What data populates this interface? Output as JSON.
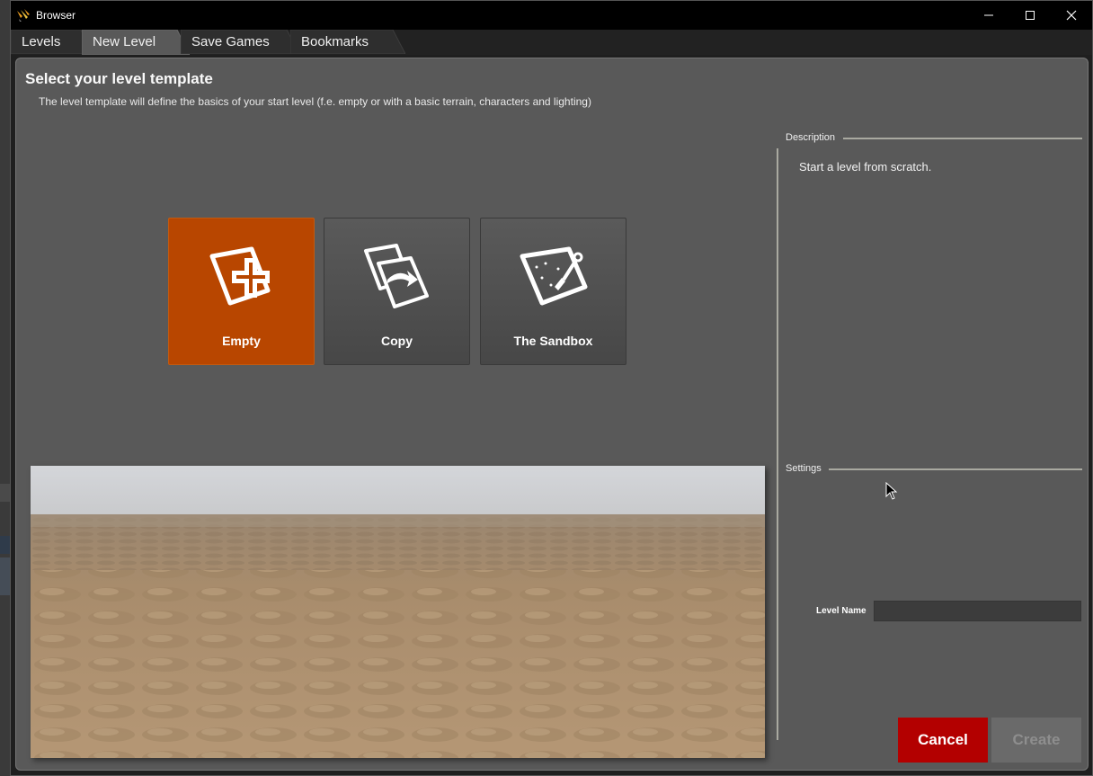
{
  "window": {
    "title": "Browser",
    "controls": {
      "minimize": "minimize-icon",
      "maximize": "maximize-icon",
      "close": "close-icon"
    }
  },
  "tabs": [
    {
      "label": "Levels",
      "active": false
    },
    {
      "label": "New Level",
      "active": true
    },
    {
      "label": "Save Games",
      "active": false
    },
    {
      "label": "Bookmarks",
      "active": false
    }
  ],
  "main": {
    "heading": "Select your level template",
    "subheading": "The level template will define the basics of your start level (f.e. empty or with a basic terrain, characters and lighting)",
    "templates": [
      {
        "label": "Empty",
        "icon": "new-level-plus-icon",
        "selected": true
      },
      {
        "label": "Copy",
        "icon": "copy-level-icon",
        "selected": false
      },
      {
        "label": "The Sandbox",
        "icon": "sandbox-shovel-icon",
        "selected": false
      }
    ],
    "preview_image": "desert-terrain-preview"
  },
  "description": {
    "title": "Description",
    "text": "Start a level from scratch."
  },
  "settings": {
    "title": "Settings",
    "level_name_label": "Level Name",
    "level_name_value": ""
  },
  "buttons": {
    "cancel": "Cancel",
    "create": "Create"
  },
  "colors": {
    "accent_selected": "#b84600",
    "cancel": "#b30000",
    "panel": "#595959"
  }
}
